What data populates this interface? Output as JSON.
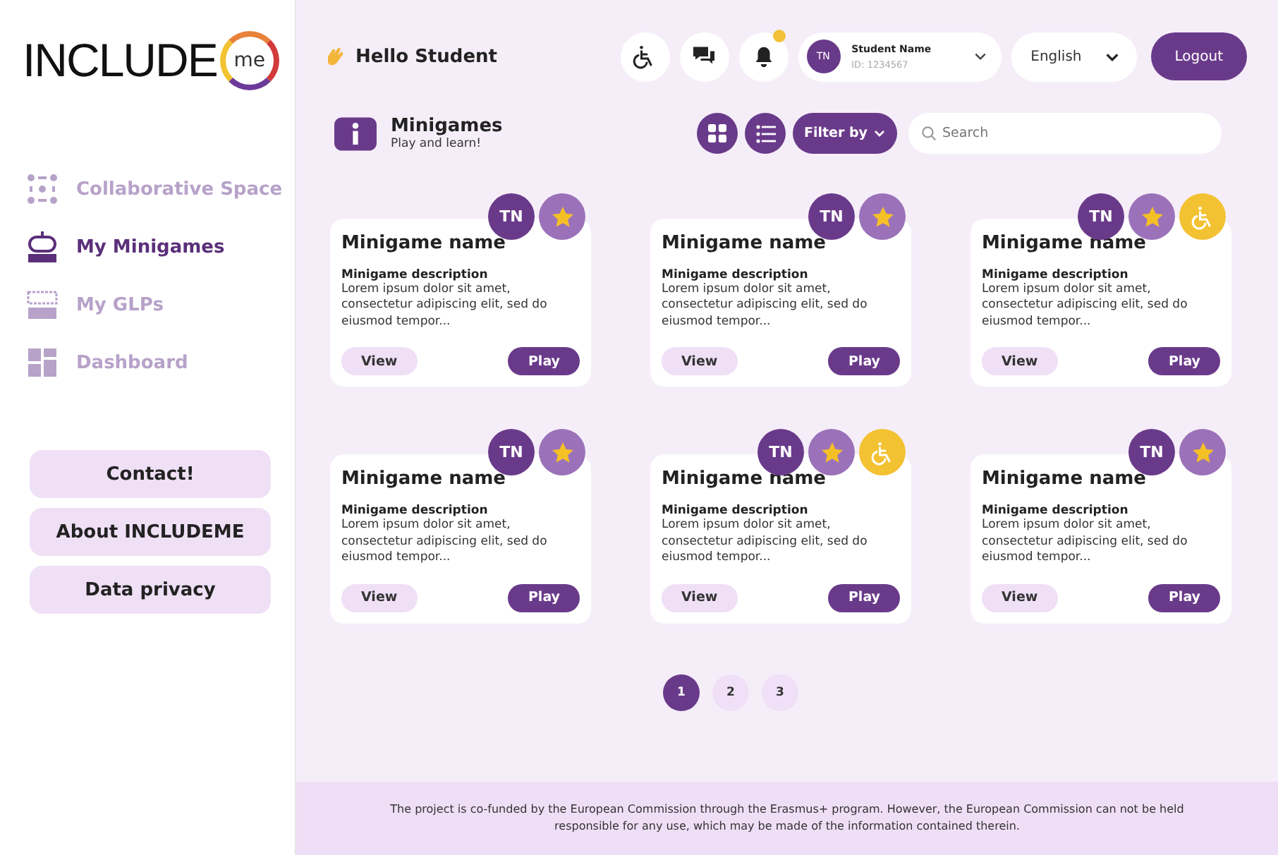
{
  "logo": {
    "word": "INCLUDE",
    "badge": "me"
  },
  "nav": [
    {
      "label": "Collaborative Space",
      "kind": "dots",
      "selected": false
    },
    {
      "label": "My Minigames",
      "kind": "game",
      "selected": true
    },
    {
      "label": "My GLPs",
      "kind": "board",
      "selected": false
    },
    {
      "label": "Dashboard",
      "kind": "grid",
      "selected": false
    }
  ],
  "side_buttons": [
    "Contact!",
    "About INCLUDEME",
    "Data privacy"
  ],
  "greeting": "Hello Student",
  "notifications": {
    "unread": true
  },
  "user": {
    "initials": "TN",
    "name": "Student Name",
    "id": "ID: 1234567"
  },
  "language": "English",
  "logout": "Logout",
  "section": {
    "title": "Minigames",
    "subtitle": "Play and learn!"
  },
  "view_buttons": [
    {
      "kind": "grid"
    },
    {
      "kind": "list"
    }
  ],
  "filter": "Filter by",
  "search": {
    "placeholder": "Search"
  },
  "cards": [
    {
      "name": "Minigame name",
      "desc_title": "Minigame description",
      "desc": "Lorem ipsum dolor sit amet, consectetur adipiscing elit, sed do eiusmod tempor...",
      "initials": "TN",
      "accessible": false,
      "view": "View",
      "play": "Play"
    },
    {
      "name": "Minigame name",
      "desc_title": "Minigame description",
      "desc": "Lorem ipsum dolor sit amet, consectetur adipiscing elit, sed do eiusmod tempor...",
      "initials": "TN",
      "accessible": false,
      "view": "View",
      "play": "Play"
    },
    {
      "name": "Minigame name",
      "desc_title": "Minigame description",
      "desc": "Lorem ipsum dolor sit amet, consectetur adipiscing elit, sed do eiusmod tempor...",
      "initials": "TN",
      "accessible": true,
      "view": "View",
      "play": "Play"
    },
    {
      "name": "Minigame name",
      "desc_title": "Minigame description",
      "desc": "Lorem ipsum dolor sit amet, consectetur adipiscing elit, sed do eiusmod tempor...",
      "initials": "TN",
      "accessible": false,
      "view": "View",
      "play": "Play"
    },
    {
      "name": "Minigame name",
      "desc_title": "Minigame description",
      "desc": "Lorem ipsum dolor sit amet, consectetur adipiscing elit, sed do eiusmod tempor...",
      "initials": "TN",
      "accessible": true,
      "view": "View",
      "play": "Play"
    },
    {
      "name": "Minigame name",
      "desc_title": "Minigame description",
      "desc": "Lorem ipsum dolor sit amet, consectetur adipiscing elit, sed do eiusmod tempor...",
      "initials": "TN",
      "accessible": false,
      "view": "View",
      "play": "Play"
    }
  ],
  "pages": [
    {
      "label": "1",
      "selected": true
    },
    {
      "label": "2",
      "selected": false
    },
    {
      "label": "3",
      "selected": false
    }
  ],
  "footer": "The project is co-funded by the European Commission through the Erasmus+ program. However, the European Commission can not be held responsible for any use, which may be made of the information contained therein."
}
